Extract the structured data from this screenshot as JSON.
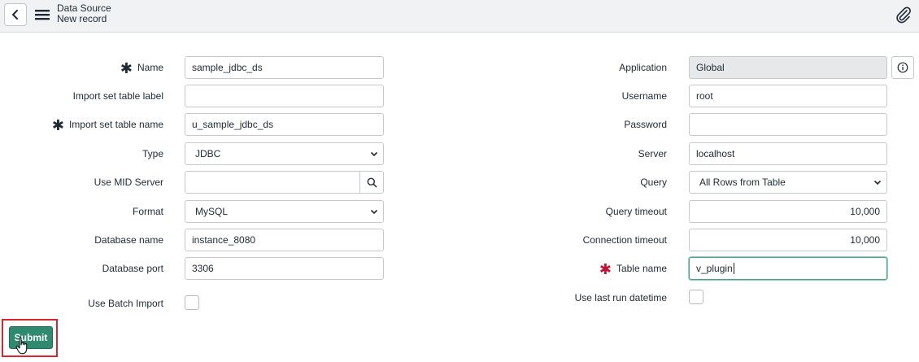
{
  "header": {
    "title": "Data Source",
    "subtitle": "New record"
  },
  "left": {
    "name": {
      "label": "Name",
      "value": "sample_jdbc_ds",
      "required": true
    },
    "import_label": {
      "label": "Import set table label",
      "value": ""
    },
    "import_name": {
      "label": "Import set table name",
      "value": "u_sample_jdbc_ds",
      "required": true
    },
    "type": {
      "label": "Type",
      "value": "JDBC"
    },
    "mid_server": {
      "label": "Use MID Server",
      "value": ""
    },
    "format": {
      "label": "Format",
      "value": "MySQL"
    },
    "db_name": {
      "label": "Database name",
      "value": "instance_8080"
    },
    "db_port": {
      "label": "Database port",
      "value": "3306"
    },
    "batch": {
      "label": "Use Batch Import",
      "checked": false
    }
  },
  "right": {
    "application": {
      "label": "Application",
      "value": "Global"
    },
    "username": {
      "label": "Username",
      "value": "root"
    },
    "password": {
      "label": "Password",
      "value": ""
    },
    "server": {
      "label": "Server",
      "value": "localhost"
    },
    "query": {
      "label": "Query",
      "value": "All Rows from Table"
    },
    "query_timeout": {
      "label": "Query timeout",
      "value": "10,000"
    },
    "conn_timeout": {
      "label": "Connection timeout",
      "value": "10,000"
    },
    "table_name": {
      "label": "Table name",
      "value": "v_plugin",
      "required": true
    },
    "last_run": {
      "label": "Use last run datetime",
      "checked": false
    }
  },
  "actions": {
    "submit": "Submit"
  },
  "colors": {
    "accent": "#2e8b6f",
    "required_red": "#c8102e",
    "highlight": "#d7262e",
    "focus": "#8fd0c1"
  }
}
